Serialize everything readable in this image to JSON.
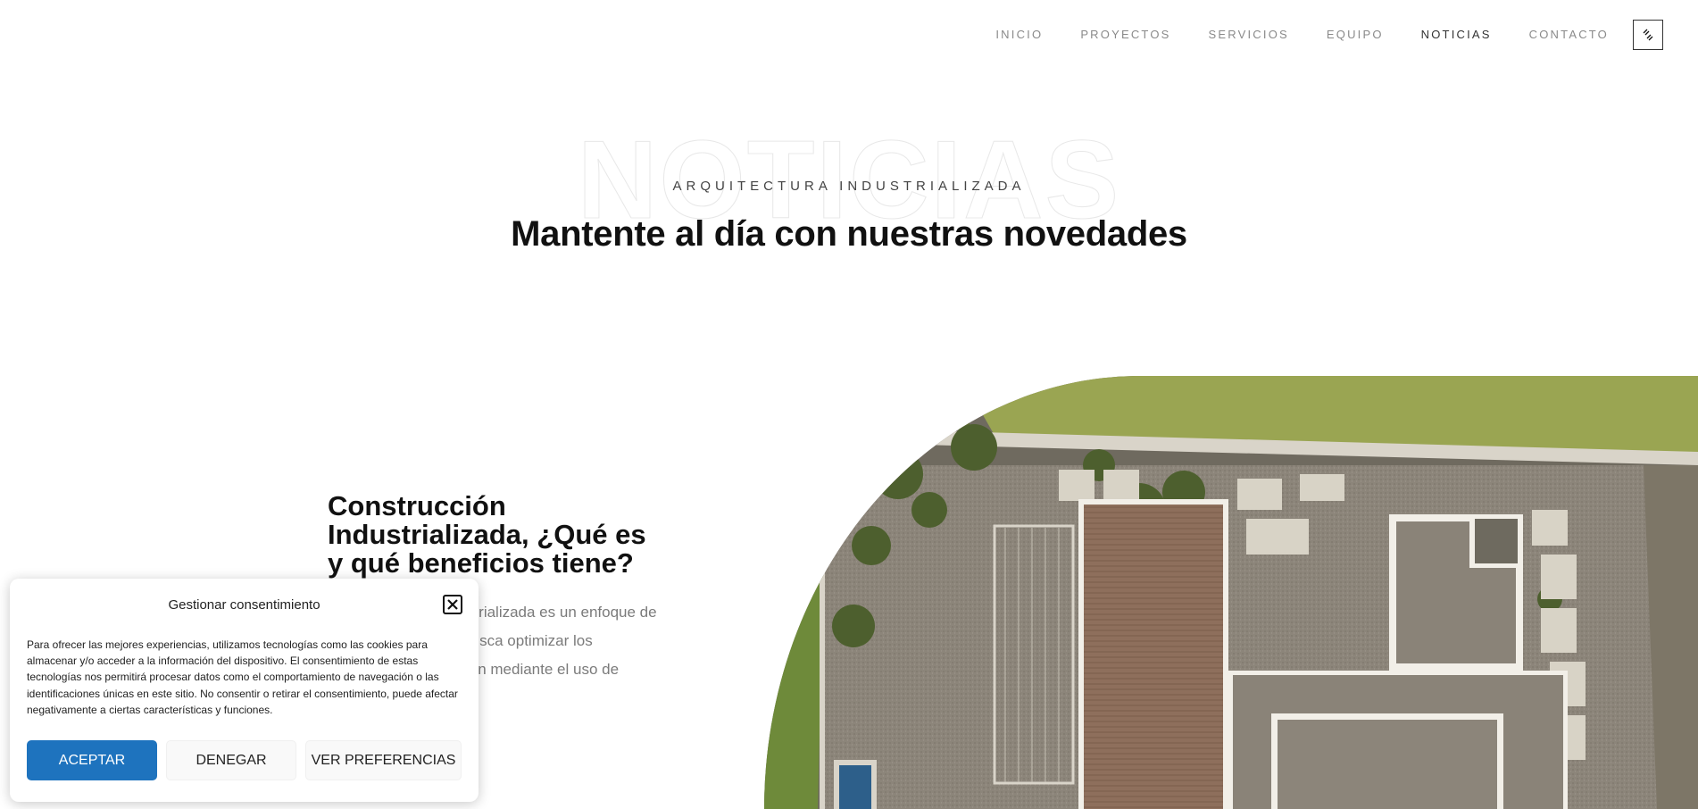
{
  "nav": {
    "items": [
      {
        "label": "INICIO",
        "active": false
      },
      {
        "label": "PROYECTOS",
        "active": false
      },
      {
        "label": "SERVICIOS",
        "active": false
      },
      {
        "label": "EQUIPO",
        "active": false
      },
      {
        "label": "NOTICIAS",
        "active": true
      },
      {
        "label": "CONTACTO",
        "active": false
      }
    ],
    "toggle_icon": "link-toggle-icon"
  },
  "hero": {
    "background_word": "NOTICIAS",
    "eyebrow": "ARQUITECTURA INDUSTRIALIZADA",
    "headline": "Mantente al día con nuestras novedades"
  },
  "article": {
    "title": "Construcción Industrializada, ¿Qué es y qué beneficios tiene?",
    "excerpt": "La construcción industrializada es un enfoque de la construcción que busca optimizar los procesos de edificación mediante el uso de sistemas"
  },
  "cookie": {
    "title": "Gestionar consentimiento",
    "text": "Para ofrecer las mejores experiencias, utilizamos tecnologías como las cookies para almacenar y/o acceder a la información del dispositivo. El consentimiento de estas tecnologías nos permitirá procesar datos como el comportamiento de navegación o las identificaciones únicas en este sitio. No consentir o retirar el consentimiento, puede afectar negativamente a ciertas características y funciones.",
    "accept": "ACEPTAR",
    "deny": "DENEGAR",
    "preferences": "VER PREFERENCIAS"
  },
  "colors": {
    "accent": "#1e73be",
    "text_dark": "#111111",
    "text_muted": "#7b7b7b"
  }
}
